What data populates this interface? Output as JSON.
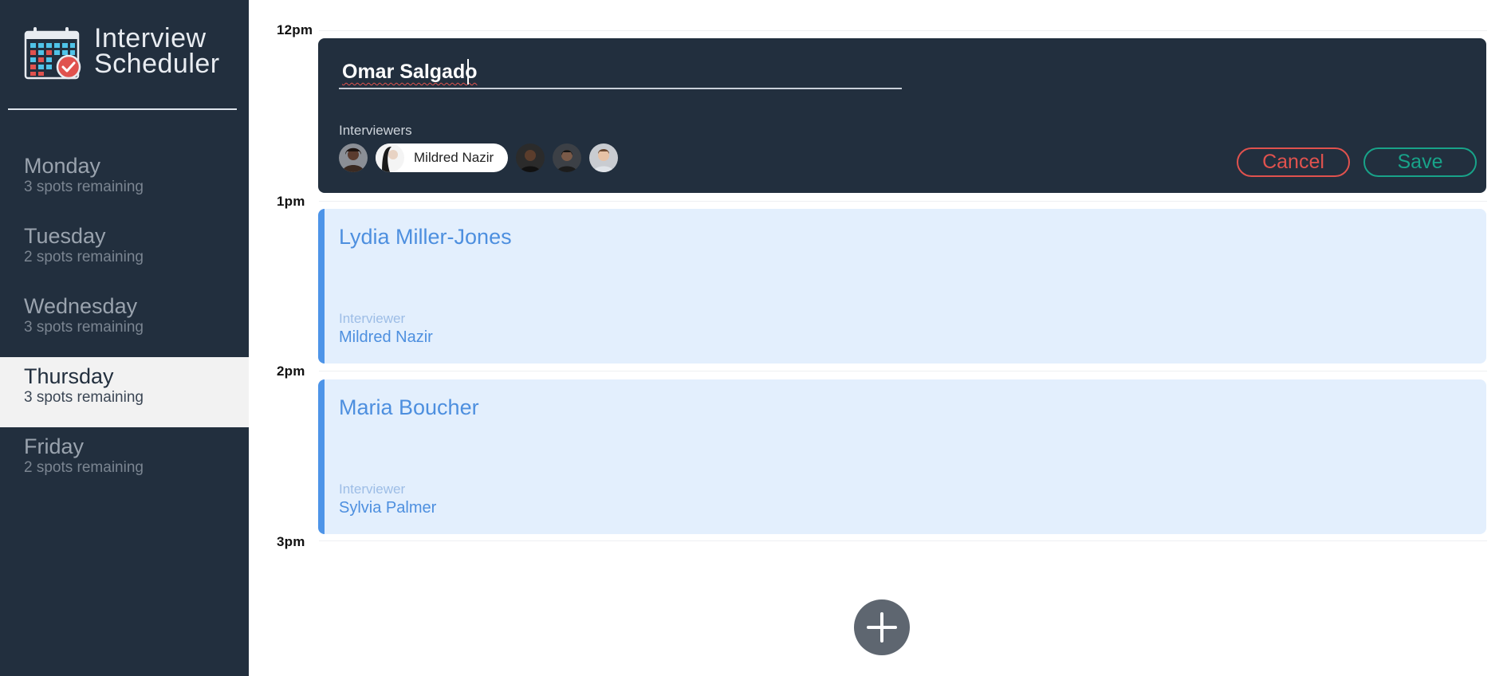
{
  "app": {
    "title_line1": "Interview",
    "title_line2": "Scheduler"
  },
  "days": [
    {
      "name": "Monday",
      "spots": "3 spots remaining"
    },
    {
      "name": "Tuesday",
      "spots": "2 spots remaining"
    },
    {
      "name": "Wednesday",
      "spots": "3 spots remaining"
    },
    {
      "name": "Thursday",
      "spots": "3 spots remaining"
    },
    {
      "name": "Friday",
      "spots": "2 spots remaining"
    }
  ],
  "selected_day": "Thursday",
  "hours": [
    "12pm",
    "1pm",
    "2pm",
    "3pm"
  ],
  "form": {
    "student_name": "Omar Salgado",
    "interviewers_label": "Interviewers",
    "selected_interviewer": "Mildred Nazir",
    "cancel_label": "Cancel",
    "save_label": "Save"
  },
  "appointments": [
    {
      "student": "Lydia Miller-Jones",
      "interviewer_label": "Interviewer",
      "interviewer": "Mildred Nazir"
    },
    {
      "student": "Maria Boucher",
      "interviewer_label": "Interviewer",
      "interviewer": "Sylvia Palmer"
    }
  ],
  "colors": {
    "sidebar": "#222f3e",
    "appointment_bg": "#e3effd",
    "appointment_accent": "#4d94e8",
    "cancel": "#e0524e",
    "save": "#18a389",
    "add_button": "#5e6670"
  }
}
